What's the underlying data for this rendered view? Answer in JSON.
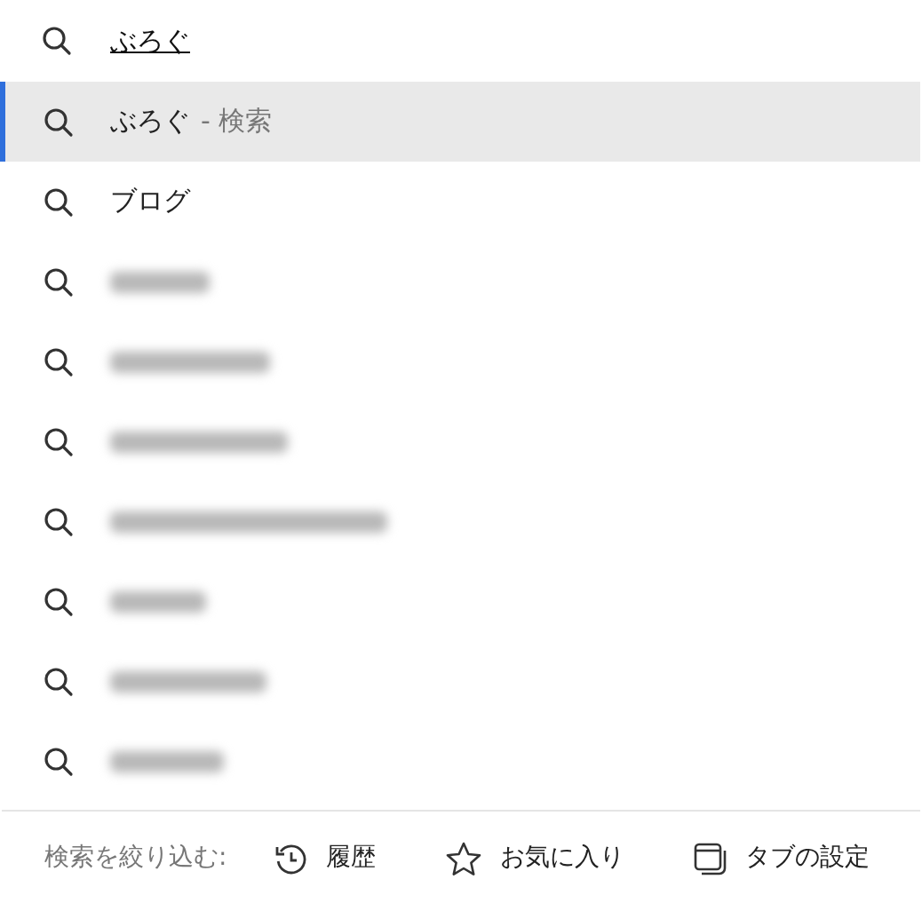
{
  "search": {
    "value": "ぶろぐ"
  },
  "suggestions": [
    {
      "kind": "text",
      "text": "ぶろぐ",
      "suffix": "- 検索",
      "selected": true
    },
    {
      "kind": "text",
      "text": "ブログ",
      "selected": false
    },
    {
      "kind": "blurred",
      "selected": false
    },
    {
      "kind": "blurred",
      "selected": false
    },
    {
      "kind": "blurred",
      "selected": false
    },
    {
      "kind": "blurred",
      "selected": false
    },
    {
      "kind": "blurred",
      "selected": false
    },
    {
      "kind": "blurred",
      "selected": false
    },
    {
      "kind": "blurred",
      "selected": false
    }
  ],
  "filter_bar": {
    "label": "検索を絞り込む:",
    "buttons": [
      {
        "kind": "history",
        "label": "履歴"
      },
      {
        "kind": "favorites",
        "label": "お気に入り"
      },
      {
        "kind": "tabs",
        "label": "タブの設定"
      }
    ]
  }
}
